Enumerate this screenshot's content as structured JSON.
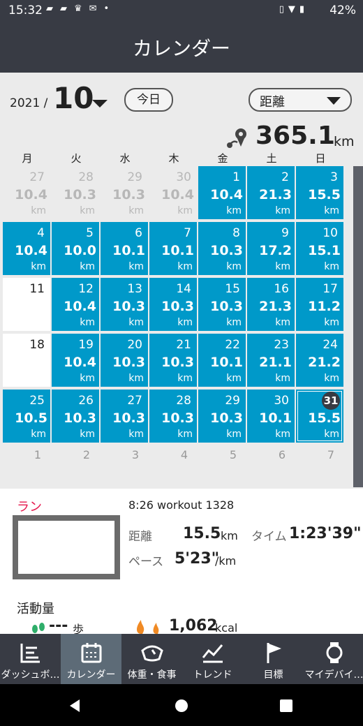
{
  "status": {
    "time": "15:32",
    "battery": "42%"
  },
  "appbar": {
    "title": "カレンダー"
  },
  "header": {
    "year": "2021 /",
    "month": "10",
    "today_button": "今日",
    "metric_select": "距離",
    "total_value": "365.1",
    "total_unit": "km"
  },
  "weekdays": [
    "月",
    "火",
    "水",
    "木",
    "金",
    "土",
    "日"
  ],
  "weeks": [
    [
      {
        "d": "27",
        "v": "10.4",
        "u": "km",
        "s": "grey"
      },
      {
        "d": "28",
        "v": "10.3",
        "u": "km",
        "s": "grey"
      },
      {
        "d": "29",
        "v": "10.3",
        "u": "km",
        "s": "grey"
      },
      {
        "d": "30",
        "v": "10.4",
        "u": "km",
        "s": "grey"
      },
      {
        "d": "1",
        "v": "10.4",
        "u": "km",
        "s": "blue"
      },
      {
        "d": "2",
        "v": "21.3",
        "u": "km",
        "s": "blue"
      },
      {
        "d": "3",
        "v": "15.5",
        "u": "km",
        "s": "blue"
      }
    ],
    [
      {
        "d": "4",
        "v": "10.4",
        "u": "km",
        "s": "blue"
      },
      {
        "d": "5",
        "v": "10.0",
        "u": "km",
        "s": "blue"
      },
      {
        "d": "6",
        "v": "10.1",
        "u": "km",
        "s": "blue"
      },
      {
        "d": "7",
        "v": "10.1",
        "u": "km",
        "s": "blue"
      },
      {
        "d": "8",
        "v": "10.3",
        "u": "km",
        "s": "blue"
      },
      {
        "d": "9",
        "v": "17.2",
        "u": "km",
        "s": "blue"
      },
      {
        "d": "10",
        "v": "15.1",
        "u": "km",
        "s": "blue"
      }
    ],
    [
      {
        "d": "11",
        "v": "",
        "u": "",
        "s": "white"
      },
      {
        "d": "12",
        "v": "10.4",
        "u": "km",
        "s": "blue"
      },
      {
        "d": "13",
        "v": "10.3",
        "u": "km",
        "s": "blue"
      },
      {
        "d": "14",
        "v": "10.3",
        "u": "km",
        "s": "blue"
      },
      {
        "d": "15",
        "v": "10.3",
        "u": "km",
        "s": "blue"
      },
      {
        "d": "16",
        "v": "21.3",
        "u": "km",
        "s": "blue"
      },
      {
        "d": "17",
        "v": "11.2",
        "u": "km",
        "s": "blue"
      }
    ],
    [
      {
        "d": "18",
        "v": "",
        "u": "",
        "s": "white"
      },
      {
        "d": "19",
        "v": "10.4",
        "u": "km",
        "s": "blue"
      },
      {
        "d": "20",
        "v": "10.3",
        "u": "km",
        "s": "blue"
      },
      {
        "d": "21",
        "v": "10.3",
        "u": "km",
        "s": "blue"
      },
      {
        "d": "22",
        "v": "10.1",
        "u": "km",
        "s": "blue"
      },
      {
        "d": "23",
        "v": "21.1",
        "u": "km",
        "s": "blue"
      },
      {
        "d": "24",
        "v": "21.2",
        "u": "km",
        "s": "blue"
      }
    ],
    [
      {
        "d": "25",
        "v": "10.5",
        "u": "km",
        "s": "blue"
      },
      {
        "d": "26",
        "v": "10.3",
        "u": "km",
        "s": "blue"
      },
      {
        "d": "27",
        "v": "10.3",
        "u": "km",
        "s": "blue"
      },
      {
        "d": "28",
        "v": "10.3",
        "u": "km",
        "s": "blue"
      },
      {
        "d": "29",
        "v": "10.3",
        "u": "km",
        "s": "blue"
      },
      {
        "d": "30",
        "v": "10.1",
        "u": "km",
        "s": "blue"
      },
      {
        "d": "31",
        "v": "15.5",
        "u": "km",
        "s": "blue sel"
      }
    ]
  ],
  "next_week_days": [
    "1",
    "2",
    "3",
    "4",
    "5",
    "6",
    "7"
  ],
  "detail": {
    "type_label": "ラン",
    "workout_title": "8:26  workout 1328",
    "distance_label": "距離",
    "distance_value": "15.5",
    "distance_unit": "km",
    "time_label": "タイム",
    "time_value": "1:23'39\"",
    "pace_label": "ペース",
    "pace_value": "5'23\"",
    "pace_unit": "/km"
  },
  "activity": {
    "label": "活動量",
    "steps_value": "---",
    "steps_unit": "歩",
    "kcal_value": "1,062",
    "kcal_unit": "kcal"
  },
  "nav": [
    "ダッシュボ…",
    "カレンダー",
    "体重・食事",
    "トレンド",
    "目標",
    "マイデバイ…"
  ],
  "colors": {
    "accent": "#0099c9",
    "bar": "#383b44",
    "run": "#e5174c",
    "grey_bg": "#ebebeb"
  }
}
